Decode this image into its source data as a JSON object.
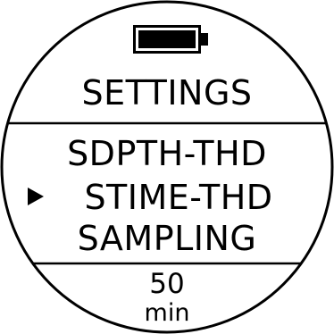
{
  "screen": {
    "title": "SETTINGS",
    "battery": {
      "icon": "battery-full-icon",
      "level": 1.0
    },
    "menu": {
      "items": [
        {
          "label": "SDPTH-THD",
          "selected": false
        },
        {
          "label": "STIME-THD",
          "selected": true
        },
        {
          "label": "SAMPLING",
          "selected": false
        }
      ],
      "pointer_icon": "triangle-right-icon"
    },
    "current_value": {
      "value": "50",
      "unit": "min"
    }
  },
  "colors": {
    "foreground": "#000000",
    "background": "#ffffff"
  }
}
